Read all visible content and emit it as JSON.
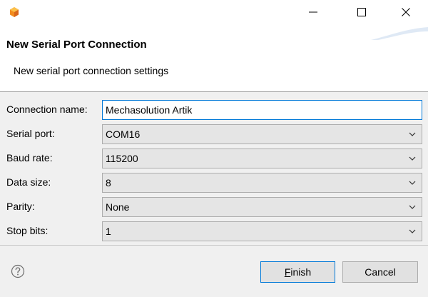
{
  "window": {
    "title": ""
  },
  "header": {
    "title": "New Serial Port Connection",
    "description": "New serial port connection settings"
  },
  "form": {
    "connection_name": {
      "label": "Connection name:",
      "value": "Mechasolution Artik"
    },
    "serial_port": {
      "label": "Serial port:",
      "value": "COM16"
    },
    "baud_rate": {
      "label": "Baud rate:",
      "value": "115200"
    },
    "data_size": {
      "label": "Data size:",
      "value": "8"
    },
    "parity": {
      "label": "Parity:",
      "value": "None"
    },
    "stop_bits": {
      "label": "Stop bits:",
      "value": "1"
    }
  },
  "footer": {
    "finish_mnemonic": "F",
    "finish_rest": "inish",
    "cancel_label": "Cancel"
  },
  "icons": {
    "app": "eclipse-cube-icon",
    "minimize": "minimize-icon",
    "maximize": "maximize-icon",
    "close": "close-icon",
    "help": "help-icon",
    "dropdown": "chevron-down-icon"
  },
  "colors": {
    "focus_border": "#0078d7",
    "combo_bg": "#e5e5e5",
    "dialog_bg": "#f0f0f0",
    "app_icon_orange": "#f28c1e"
  }
}
